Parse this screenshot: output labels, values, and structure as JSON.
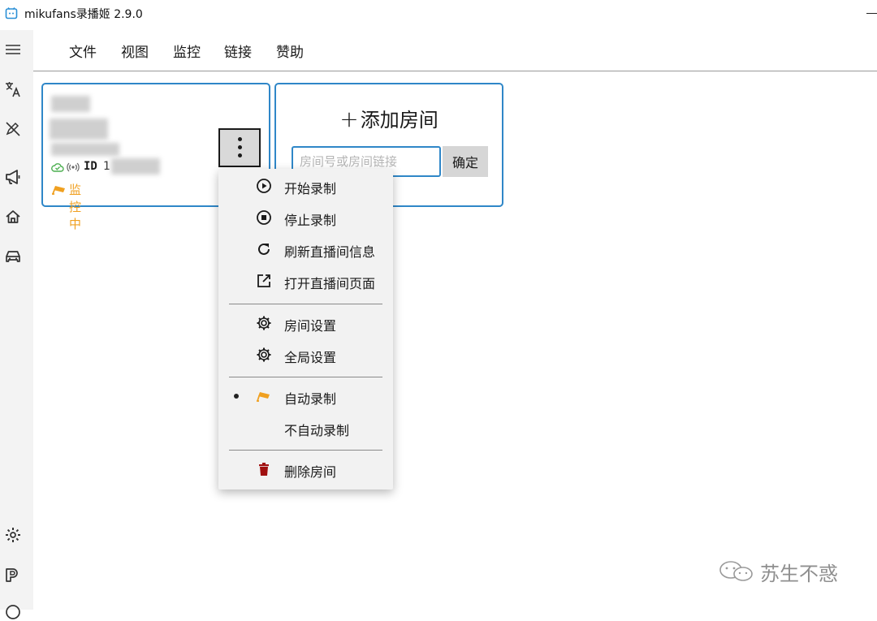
{
  "window": {
    "title": "mikufans录播姬 2.9.0"
  },
  "menubar": {
    "items": [
      "文件",
      "视图",
      "监控",
      "链接",
      "赞助"
    ]
  },
  "sidebar": {
    "icons": [
      "menu-icon",
      "translate-icon",
      "edit-off-icon",
      "megaphone-icon",
      "home-icon",
      "car-icon",
      "settings-icon",
      "parking-icon"
    ]
  },
  "room_card": {
    "id_label": "ID",
    "id_value": "1",
    "status_text": "监控中",
    "colors": {
      "monitor": "#f0a020",
      "cloud": "#4caf50",
      "border": "#2f87c8"
    }
  },
  "add_room": {
    "plus": "+",
    "title": "添加房间",
    "input_placeholder": "房间号或房间链接",
    "confirm_label": "确定"
  },
  "context_menu": {
    "start_record": "开始录制",
    "stop_record": "停止录制",
    "refresh_info": "刷新直播间信息",
    "open_page": "打开直播间页面",
    "room_settings": "房间设置",
    "global_settings": "全局设置",
    "auto_record": "自动录制",
    "no_auto_record": "不自动录制",
    "delete_room": "删除房间",
    "selected_mode": "auto_record",
    "delete_color": "#a01010"
  },
  "watermark": {
    "text": "苏生不惑"
  }
}
